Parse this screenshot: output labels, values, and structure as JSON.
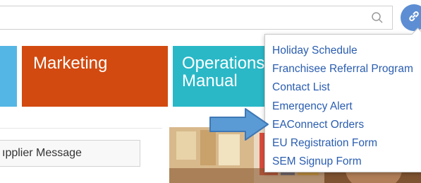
{
  "search": {
    "value": "",
    "placeholder": ""
  },
  "icons": {
    "search": "search-icon",
    "link": "link-icon",
    "arrow": "arrow-right-icon"
  },
  "tiles": [
    {
      "label": "",
      "color": "#54b6e4"
    },
    {
      "label": "Marketing",
      "color": "#d24a10"
    },
    {
      "label": "Operations\nManual",
      "color": "#2ab8c7"
    }
  ],
  "supplier_button": {
    "label": "ıpplier Message"
  },
  "dropdown": {
    "items": [
      "Holiday Schedule",
      "Franchisee Referral Program",
      "Contact List",
      "Emergency Alert",
      "EAConnect Orders",
      "EU Registration Form",
      "SEM Signup Form"
    ]
  },
  "colors": {
    "link_text": "#2a5db0",
    "link_button": "#5d8ed3",
    "arrow": "#5b9bd5"
  }
}
